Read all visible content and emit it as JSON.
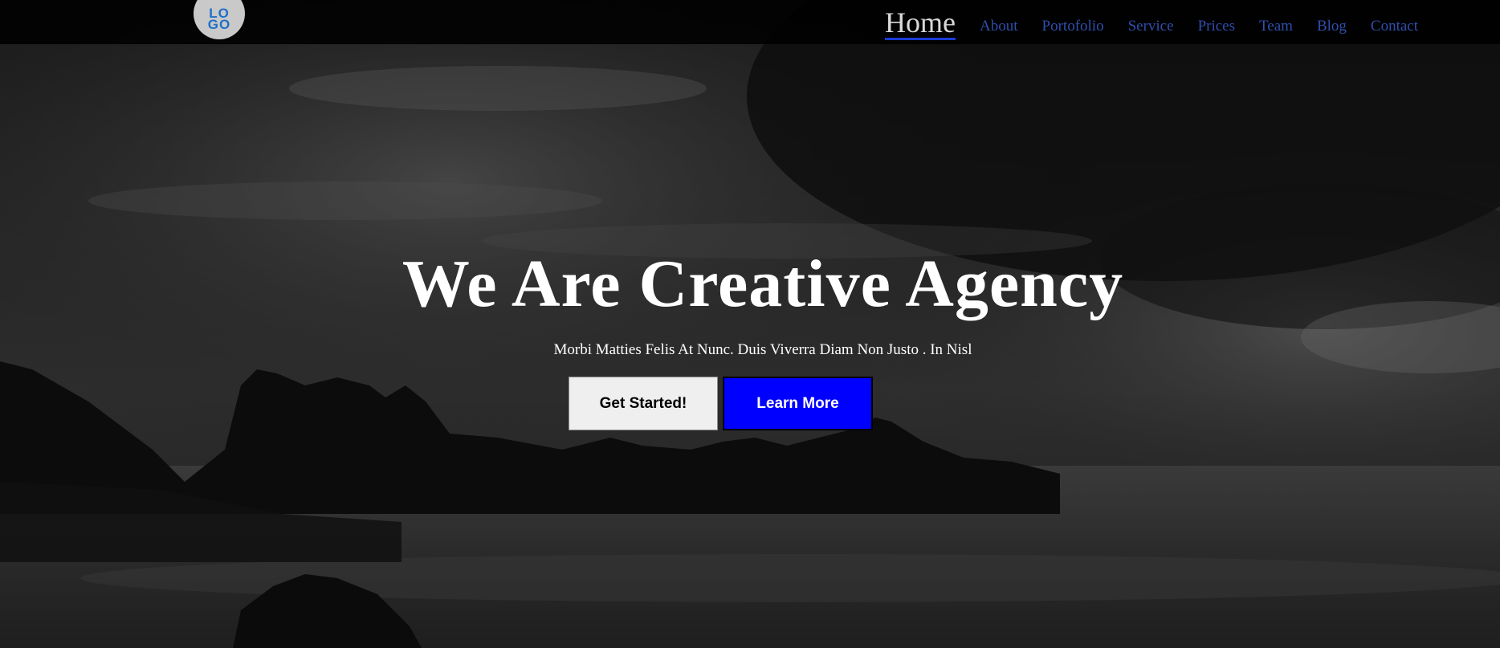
{
  "logo": {
    "line1": "LO",
    "line2": "GO",
    "color": "#1f6fc9"
  },
  "nav": {
    "items": [
      {
        "label": "Home",
        "active": true
      },
      {
        "label": "About"
      },
      {
        "label": "Portofolio"
      },
      {
        "label": "Service"
      },
      {
        "label": "Prices"
      },
      {
        "label": "Team"
      },
      {
        "label": "Blog"
      },
      {
        "label": "Contact"
      }
    ],
    "link_color": "#2f4fae",
    "active_underline_color": "#1a3bd8"
  },
  "hero": {
    "title": "We Are Creative Agency",
    "subtitle": "Morbi Matties Felis At Nunc. Duis Viverra Diam Non Justo . In Nisl",
    "primary_button": "Get Started!",
    "secondary_button": "Learn More",
    "secondary_button_color": "#0000ff"
  }
}
